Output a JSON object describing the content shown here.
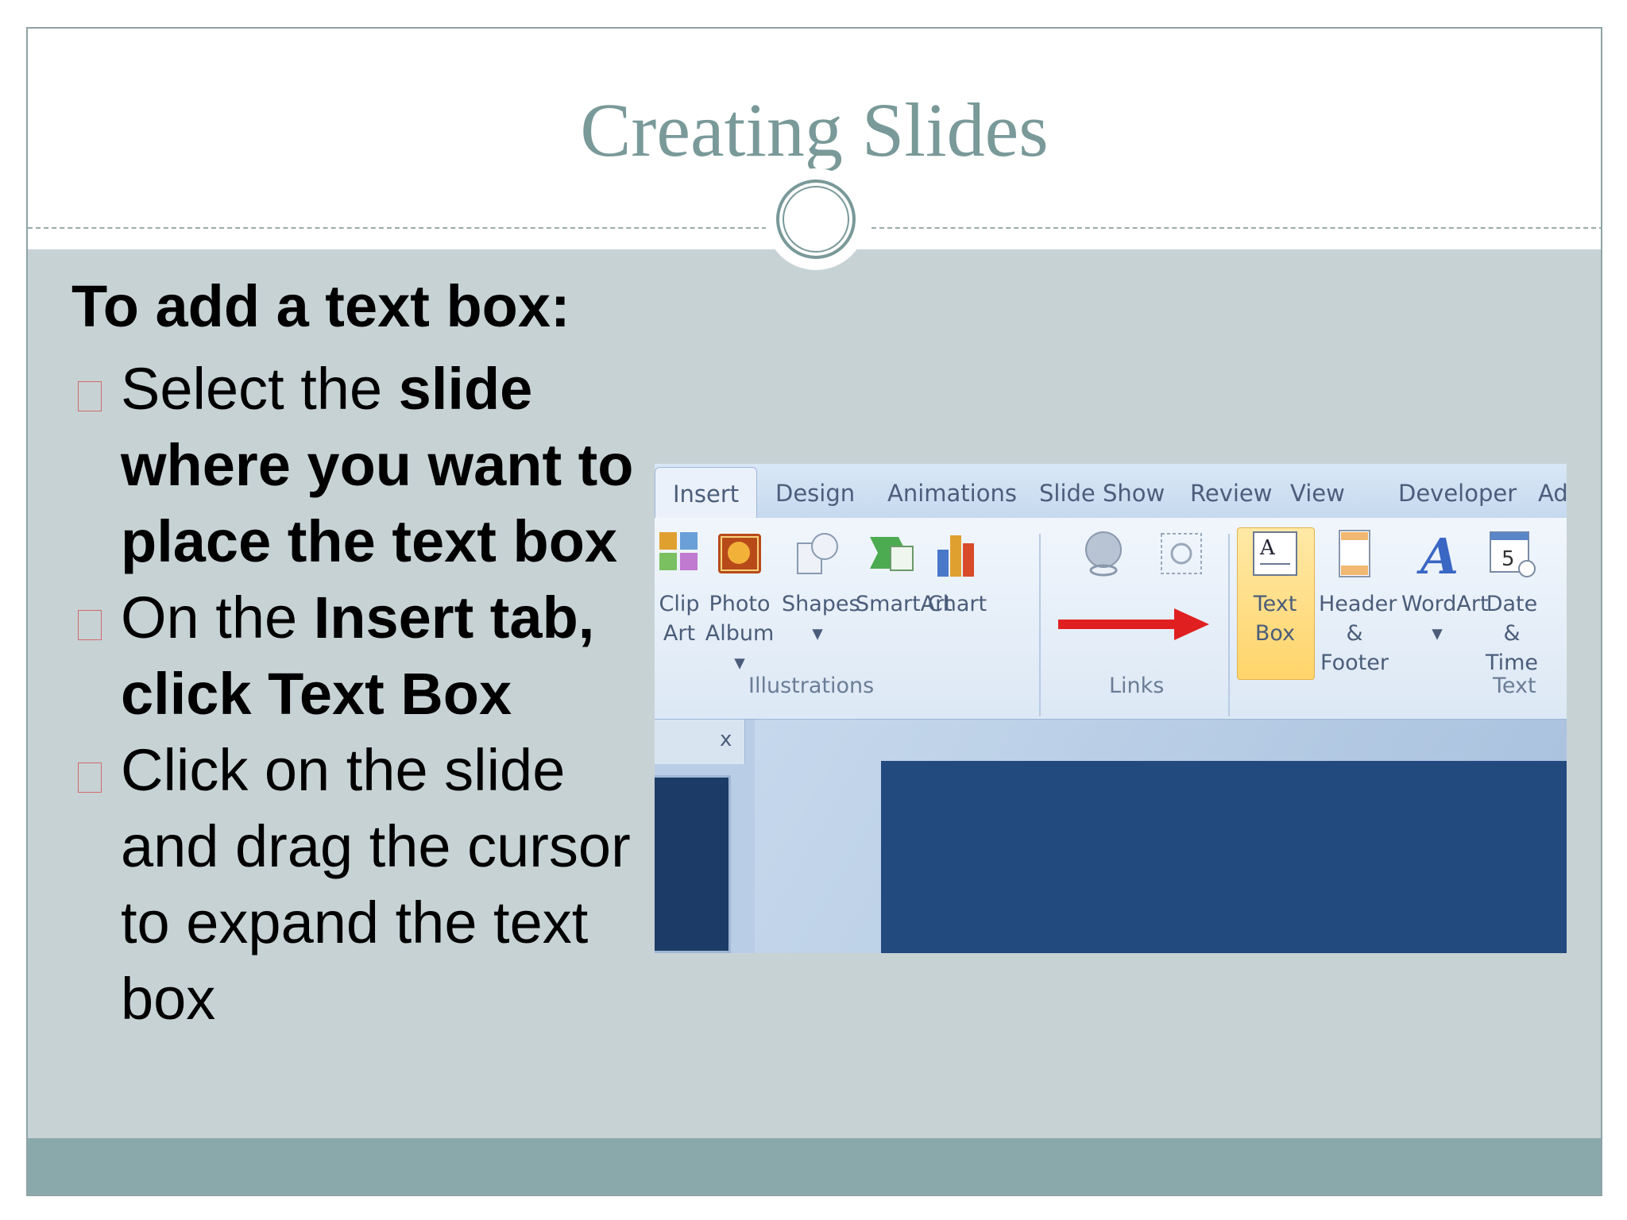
{
  "slide": {
    "title": "Creating Slides",
    "lead": "To add a text box:",
    "bullets": [
      {
        "t1": "Select the ",
        "t2": "slide where you want to place the text box"
      },
      {
        "t1": "On the ",
        "t2": "Insert tab, click Text Box"
      },
      {
        "t1": "Click on the slide and drag the cursor to expand the text box",
        "t2": ""
      }
    ]
  },
  "screenshot": {
    "tabs": [
      "Insert",
      "Design",
      "Animations",
      "Slide Show",
      "Review",
      "View",
      "Developer",
      "Ad"
    ],
    "tools": [
      {
        "l1": "Clip",
        "l2": "Art"
      },
      {
        "l1": "Photo",
        "l2": "Album ▾"
      },
      {
        "l1": "Shapes",
        "l2": "▾"
      },
      {
        "l1": "SmartArt",
        "l2": ""
      },
      {
        "l1": "Chart",
        "l2": ""
      },
      {
        "l1": "Text",
        "l2": "Box"
      },
      {
        "l1": "Header",
        "l2": "& Footer"
      },
      {
        "l1": "WordArt",
        "l2": "▾"
      },
      {
        "l1": "Date",
        "l2": "& Time"
      }
    ],
    "groups": [
      "Illustrations",
      "Links",
      "Text"
    ],
    "close_glyph": "x"
  },
  "colors": {
    "title": "#7a9999",
    "body_bg": "#c7d2d5",
    "footer_bg": "#8aa9aa",
    "arrow": "#e02020",
    "textbox_highlight": "#ffd46b"
  }
}
